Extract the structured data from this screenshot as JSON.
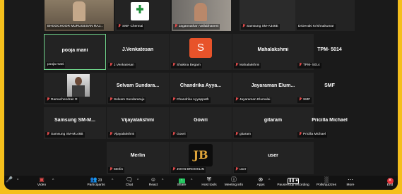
{
  "tiles": [
    {
      "label": "BHOOCHOOR MURUGESAN RAJ...",
      "mic_muted": false
    },
    {
      "label": "SMF Chennai",
      "mic_muted": true
    },
    {
      "label": "Jagannathan Vallabhaneni",
      "mic_muted": true
    },
    {
      "label": "Samsung SM-A346E",
      "mic_muted": true
    },
    {
      "label": "DrDevaki Krishnakumar",
      "mic_muted": false
    },
    {
      "name": "pooja mani",
      "label": "pooja mani",
      "mic_muted": false,
      "active": true
    },
    {
      "name": "J.Venkatesan",
      "label": "J.Venkatesan",
      "mic_muted": true
    },
    {
      "name": "",
      "label": "Shakina Begam",
      "mic_muted": true,
      "avatar_letter": "S",
      "avatar_color": "#e8532a"
    },
    {
      "name": "Mahalakshmi",
      "label": "Mahalakshmi",
      "mic_muted": true
    },
    {
      "name": "TPM- 5014",
      "label": "TPM- 5014",
      "mic_muted": true
    },
    {
      "name": "",
      "label": "Ramachendran R",
      "mic_muted": true,
      "photo": true
    },
    {
      "name": "Selvam Sundara...",
      "label": "Selvam Sundararaju",
      "mic_muted": true
    },
    {
      "name": "Chandrika Ayya...",
      "label": "Chandrika Ayyappath",
      "mic_muted": true
    },
    {
      "name": "Jayaraman Elum...",
      "label": "Jayaraman Elumalai",
      "mic_muted": true
    },
    {
      "name": "SMF",
      "label": "SMF",
      "mic_muted": true
    },
    {
      "name": "Samsung SM-M...",
      "label": "Samsung SM-M146B",
      "mic_muted": true
    },
    {
      "name": "Vijayalakshmi",
      "label": "Vijayalakshmi",
      "mic_muted": true
    },
    {
      "name": "Gowri",
      "label": "Gowri",
      "mic_muted": true
    },
    {
      "name": "gitaram",
      "label": "gitaram",
      "mic_muted": true
    },
    {
      "name": "Pricilla Michael",
      "label": "Pricilla Michael",
      "mic_muted": true
    },
    {
      "name": "Merlin",
      "label": "Merlin",
      "mic_muted": true
    },
    {
      "name": "",
      "label": "JOHN BROOKLIN",
      "mic_muted": true,
      "avatar_letter": "JB"
    },
    {
      "name": "user",
      "label": "user",
      "mic_muted": true
    }
  ],
  "toolbar": {
    "video": "Video",
    "participants": "Participants",
    "participants_count": "23",
    "chat": "Chat",
    "react": "React",
    "share": "Share",
    "host_tools": "Host tools",
    "meeting_info": "Meeting info",
    "apps": "Apps",
    "pause_recording": "Pause/stop recording",
    "polls": "Polls/quizzes",
    "more": "More",
    "end": "End"
  },
  "colors": {
    "accent_green": "#22c55e",
    "end_red": "#e5333a",
    "muted_red": "#e04b4b"
  }
}
